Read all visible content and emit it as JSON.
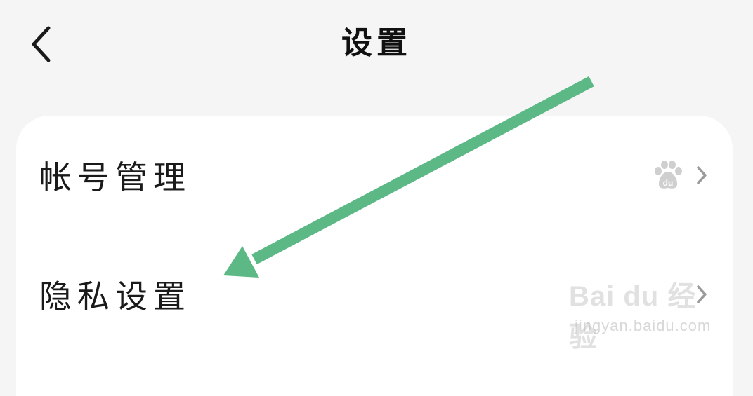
{
  "header": {
    "title": "设置",
    "back_icon": "chevron-left-icon"
  },
  "settings": {
    "items": [
      {
        "label": "帐号管理",
        "trailing_icon": "baidu-paw-icon",
        "chevron": "chevron-right-icon"
      },
      {
        "label": "隐私设置",
        "chevron": "chevron-right-icon"
      }
    ]
  },
  "annotation": {
    "arrow_color": "#5cb885"
  },
  "watermark": {
    "logo": "Bai  du 经验",
    "url": "jingyan.baidu.com"
  }
}
